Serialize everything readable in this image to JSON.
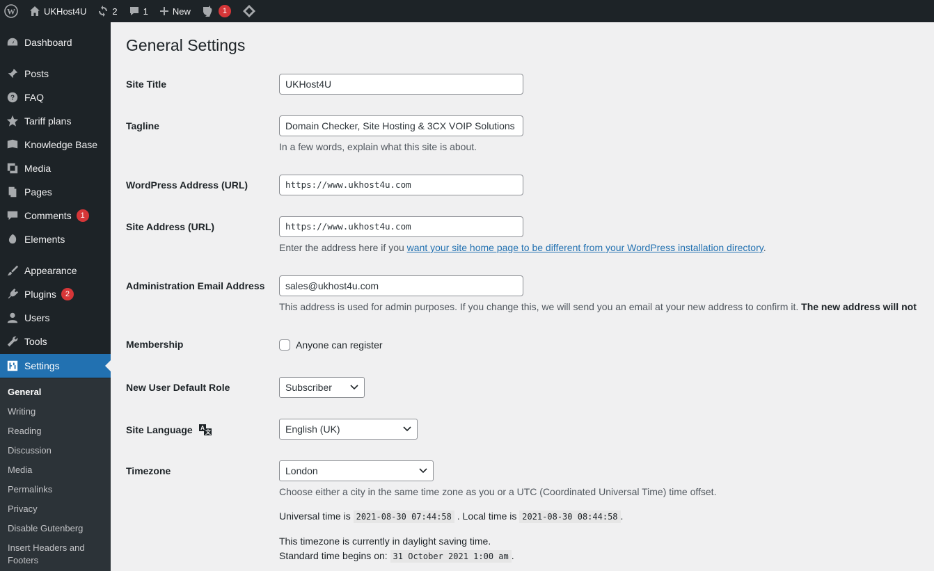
{
  "adminbar": {
    "site_name": "UKHost4U",
    "updates_count": "2",
    "comments_count": "1",
    "new_label": "New",
    "yoast_badge": "1"
  },
  "sidebar": {
    "items": [
      {
        "label": "Dashboard",
        "icon": "dashboard-icon"
      },
      {
        "label": "Posts",
        "icon": "pin-icon"
      },
      {
        "label": "FAQ",
        "icon": "help-icon"
      },
      {
        "label": "Tariff plans",
        "icon": "star-icon"
      },
      {
        "label": "Knowledge Base",
        "icon": "book-icon"
      },
      {
        "label": "Media",
        "icon": "media-icon"
      },
      {
        "label": "Pages",
        "icon": "page-icon"
      },
      {
        "label": "Comments",
        "icon": "comment-icon",
        "badge": "1"
      },
      {
        "label": "Elements",
        "icon": "elements-icon"
      },
      {
        "label": "Appearance",
        "icon": "brush-icon"
      },
      {
        "label": "Plugins",
        "icon": "plug-icon",
        "badge": "2"
      },
      {
        "label": "Users",
        "icon": "user-icon"
      },
      {
        "label": "Tools",
        "icon": "wrench-icon"
      },
      {
        "label": "Settings",
        "icon": "settings-icon"
      }
    ],
    "submenu": [
      "General",
      "Writing",
      "Reading",
      "Discussion",
      "Media",
      "Permalinks",
      "Privacy",
      "Disable Gutenberg",
      "Insert Headers and Footers"
    ]
  },
  "page": {
    "title": "General Settings",
    "site_title_label": "Site Title",
    "site_title_value": "UKHost4U",
    "tagline_label": "Tagline",
    "tagline_value": "Domain Checker, Site Hosting & 3CX VOIP Solutions",
    "tagline_desc": "In a few words, explain what this site is about.",
    "wp_address_label": "WordPress Address (URL)",
    "wp_address_value": "https://www.ukhost4u.com",
    "site_address_label": "Site Address (URL)",
    "site_address_value": "https://www.ukhost4u.com",
    "site_address_desc_pre": "Enter the address here if you ",
    "site_address_desc_link": "want your site home page to be different from your WordPress installation directory",
    "site_address_desc_post": ".",
    "admin_email_label": "Administration Email Address",
    "admin_email_value": "sales@ukhost4u.com",
    "admin_email_desc": "This address is used for admin purposes. If you change this, we will send you an email at your new address to confirm it. ",
    "admin_email_desc_bold": "The new address will not",
    "membership_label": "Membership",
    "membership_checkbox": "Anyone can register",
    "default_role_label": "New User Default Role",
    "default_role_value": "Subscriber",
    "language_label": "Site Language",
    "language_value": "English (UK)",
    "timezone_label": "Timezone",
    "timezone_value": "London",
    "timezone_desc": "Choose either a city in the same time zone as you or a UTC (Coordinated Universal Time) time offset.",
    "utc_label": "Universal time is",
    "utc_value": "2021-08-30 07:44:58",
    "local_label": ". Local time is",
    "local_value": "2021-08-30 08:44:58",
    "local_post": ".",
    "dst_line": "This timezone is currently in daylight saving time.",
    "std_label": "Standard time begins on:",
    "std_value": "31 October 2021 1:00 am",
    "std_post": "."
  },
  "colors": {
    "admin_bg": "#1d2327",
    "accent": "#2271b1",
    "badge": "#d63638",
    "content_bg": "#f0f0f1"
  }
}
